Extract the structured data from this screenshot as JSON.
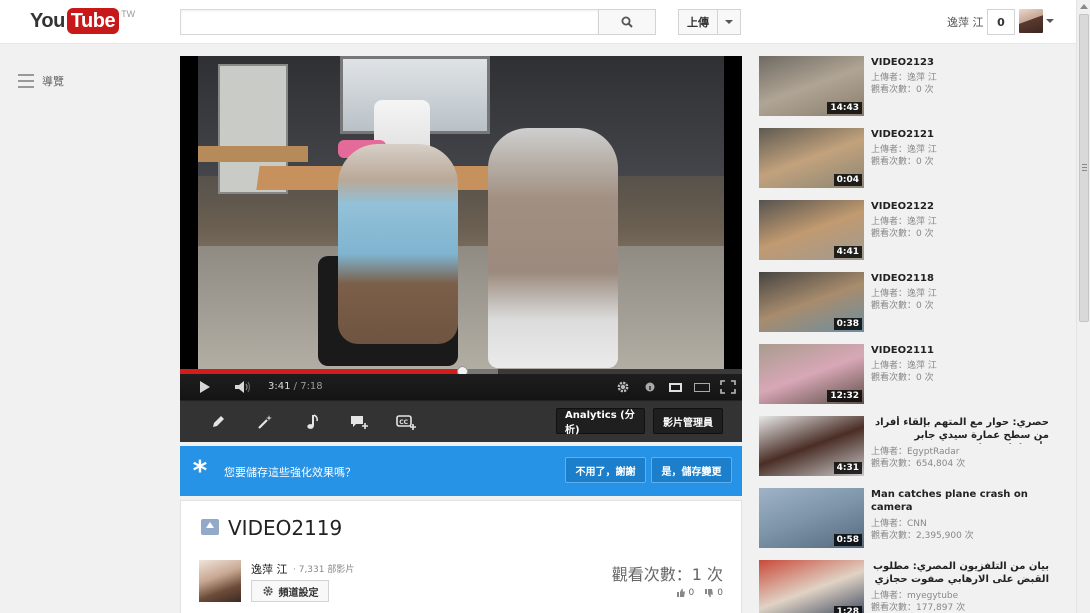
{
  "header": {
    "logo_you": "You",
    "logo_tube": "Tube",
    "logo_region": "TW",
    "search_placeholder": "",
    "upload_label": "上傳",
    "username": "逸萍 江",
    "notification_count": "0"
  },
  "guide": {
    "label": "導覽"
  },
  "player": {
    "current_time": "3:41",
    "separator": " / ",
    "duration": "7:18",
    "progress_fraction": 0.504,
    "loaded_fraction": 0.565
  },
  "edit_toolbar": {
    "analytics_label": "Analytics (分析)",
    "video_manager_label": "影片管理員"
  },
  "enhance_banner": {
    "prompt": "您要儲存這些強化效果嗎？",
    "decline_label": "不用了，謝謝",
    "accept_label": "是，儲存變更"
  },
  "video_info": {
    "title": "VIDEO2119",
    "owner_name": "逸萍 江",
    "owner_video_count": "· 7,331 部影片",
    "channel_settings_label": "頻道設定",
    "views": "觀看次數：1 次",
    "likes": "0",
    "dislikes": "0"
  },
  "sidebar": {
    "items": [
      {
        "title": "VIDEO2123",
        "uploader": "上傳者：逸萍 江",
        "views": "觀看次數：0 次",
        "duration": "14:43",
        "colors": [
          "#6f6a62",
          "#b0a595",
          "#8a7d6c"
        ]
      },
      {
        "title": "VIDEO2121",
        "uploader": "上傳者：逸萍 江",
        "views": "觀看次數：0 次",
        "duration": "0:04",
        "colors": [
          "#5f5a52",
          "#c2a27c",
          "#8c8676"
        ]
      },
      {
        "title": "VIDEO2122",
        "uploader": "上傳者：逸萍 江",
        "views": "觀看次數：0 次",
        "duration": "4:41",
        "colors": [
          "#55534f",
          "#c19a70",
          "#9f9b93"
        ]
      },
      {
        "title": "VIDEO2118",
        "uploader": "上傳者：逸萍 江",
        "views": "觀看次數：0 次",
        "duration": "0:38",
        "colors": [
          "#474542",
          "#a88c6d",
          "#6c8fa1"
        ]
      },
      {
        "title": "VIDEO2111",
        "uploader": "上傳者：逸萍 江",
        "views": "觀看次數：0 次",
        "duration": "12:32",
        "colors": [
          "#a99c8d",
          "#d8a7b7",
          "#5e4f46"
        ]
      },
      {
        "title": "حصري: حوار مع المتهم بإلقاء أفراد من سطح عمارة سيدي جابر وأعترافات خطيرة",
        "uploader": "上傳者：EgyptRadar",
        "views": "觀看次數：654,804 次",
        "duration": "4:31",
        "colors": [
          "#e8e8e8",
          "#4a2e26",
          "#c9c9c9"
        ],
        "rtl": true
      },
      {
        "title": "Man catches plane crash on camera",
        "uploader": "上傳者：CNN",
        "views": "觀看次數：2,395,900 次",
        "duration": "0:58",
        "colors": [
          "#9fb3c7",
          "#7c93a8",
          "#566a7c"
        ]
      },
      {
        "title": "بيان من التلفزيون المصري: مطلوب القبض على الارهابي صفوت حجازي",
        "uploader": "上傳者：myegytube",
        "views": "觀看次數：177,897 次",
        "duration": "1:28",
        "colors": [
          "#c94a3a",
          "#e0d3c5",
          "#2e3c55"
        ],
        "rtl": true
      }
    ]
  }
}
